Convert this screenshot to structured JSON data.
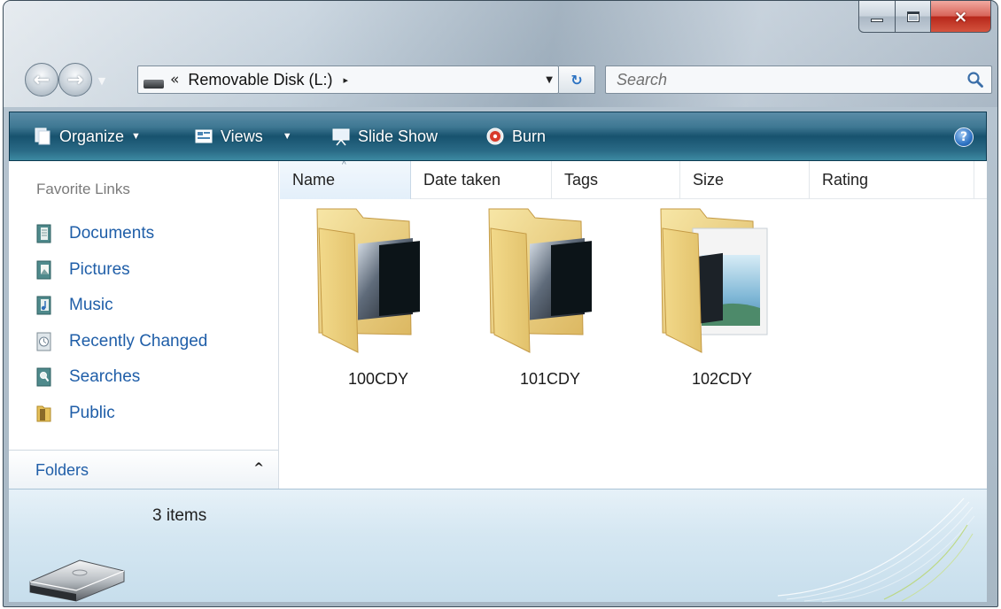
{
  "window": {
    "caption_buttons": {
      "minimize": "minimize-icon",
      "maximize": "maximize-icon",
      "close": "×"
    }
  },
  "address_bar": {
    "overflow_chevron": "«",
    "location": "Removable Disk (L:)",
    "breadcrumb_arrow": "▸",
    "dropdown_glyph": "▼",
    "refresh_glyph": "↻"
  },
  "search": {
    "placeholder": "Search"
  },
  "command_bar": {
    "items": [
      {
        "label": "Organize",
        "icon": "organize-icon",
        "has_dropdown": true
      },
      {
        "label": "Views",
        "icon": "views-icon",
        "has_dropdown": true
      },
      {
        "label": "Slide Show",
        "icon": "slide-show-icon",
        "has_dropdown": false
      },
      {
        "label": "Burn",
        "icon": "burn-icon",
        "has_dropdown": false
      }
    ],
    "dropdown_caret": "▼",
    "help_glyph": "?"
  },
  "navigation_pane": {
    "heading": "Favorite Links",
    "links": [
      {
        "label": "Documents",
        "icon": "documents-icon"
      },
      {
        "label": "Pictures",
        "icon": "pictures-icon"
      },
      {
        "label": "Music",
        "icon": "music-icon"
      },
      {
        "label": "Recently Changed",
        "icon": "recently-changed-icon"
      },
      {
        "label": "Searches",
        "icon": "searches-icon"
      },
      {
        "label": "Public",
        "icon": "public-icon"
      }
    ],
    "folders_label": "Folders",
    "folders_chevron": "^"
  },
  "file_list": {
    "columns": [
      "Name",
      "Date taken",
      "Tags",
      "Size",
      "Rating"
    ],
    "sorted_column": "Name",
    "sort_glyph": "^",
    "items": [
      {
        "name": "100CDY",
        "icon": "photo-folder-icon"
      },
      {
        "name": "101CDY",
        "icon": "photo-folder-icon"
      },
      {
        "name": "102CDY",
        "icon": "picture-folder-icon"
      }
    ]
  },
  "details_pane": {
    "item_count": "3 items",
    "icon": "removable-disk-icon"
  },
  "colors": {
    "link_blue": "#1f5ea8",
    "command_bar": "#17526e",
    "close_red": "#b7281b"
  }
}
